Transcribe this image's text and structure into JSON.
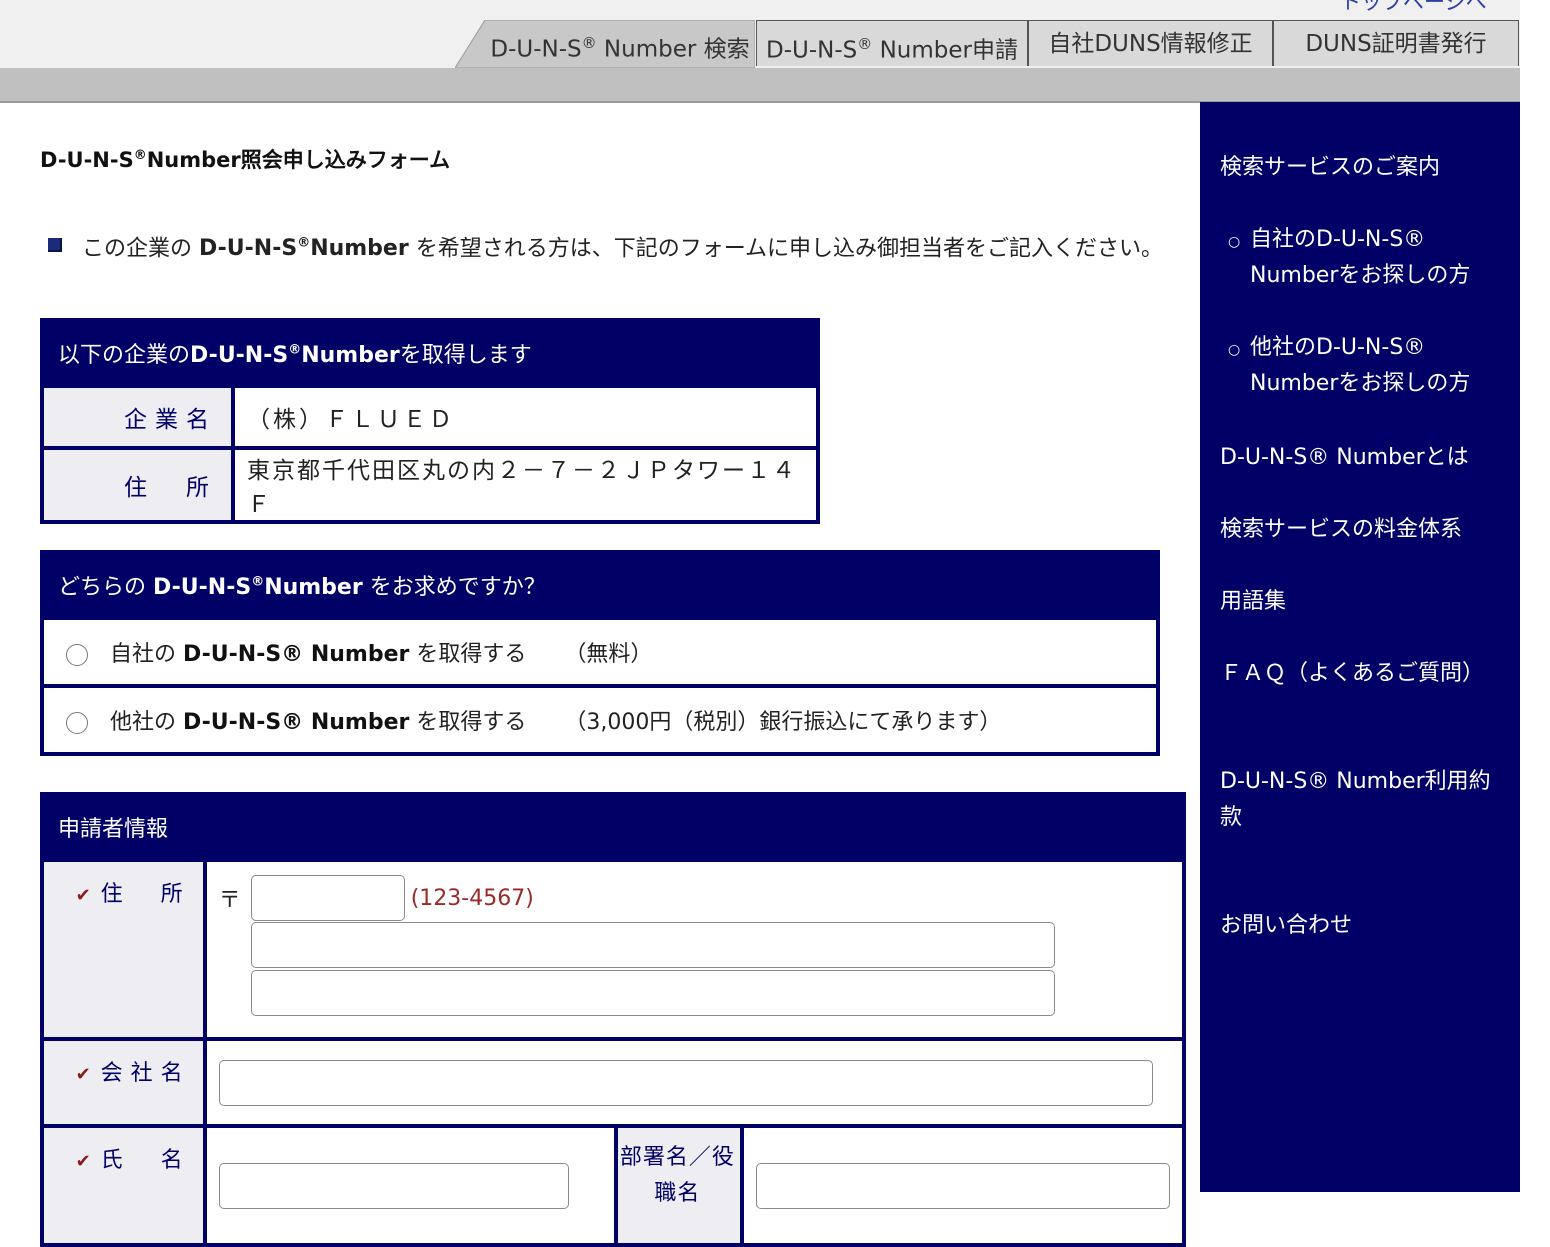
{
  "header": {
    "top_link": "トップページへ",
    "tabs": [
      {
        "label": "D-U-N-S",
        "reg": "®",
        "suffix": " Number 検索"
      },
      {
        "label": "D-U-N-S",
        "reg": "®",
        "suffix": " Number申請"
      },
      {
        "label": "自社DUNS情報修正"
      },
      {
        "label": "DUNS証明書発行"
      }
    ]
  },
  "main": {
    "heading": {
      "prefix": "D-U-N-S",
      "reg": "®",
      "suffix": "Number照会申し込みフォーム"
    },
    "notice": {
      "before": "この企業の ",
      "bold": "D-U-N-S",
      "reg": "®",
      "bold_suffix": "Number",
      "after": " を希望される方は、下記のフォームに申し込み御担当者をご記入ください。"
    },
    "company_box": {
      "title_before": "以下の企業の",
      "title_bold": "D-U-N-S",
      "title_reg": "®",
      "title_bold_suffix": "Number",
      "title_after": "を取得します",
      "name_label": "企業名",
      "name_value": "（株）ＦＬＵＥＤ",
      "address_label": "住　所",
      "address_value": "東京都千代田区丸の内２－７－２ＪＰタワー１４Ｆ"
    },
    "choice_box": {
      "title_before": "どちらの ",
      "title_bold": "D-U-N-S",
      "title_reg": "®",
      "title_bold_suffix": "Number",
      "title_after": " をお求めですか？",
      "options": [
        {
          "before": "自社の ",
          "bold": "D-U-N-S® Number",
          "after": " を取得する",
          "price": "（無料）"
        },
        {
          "before": "他社の ",
          "bold": "D-U-N-S® Number",
          "after": " を取得する",
          "price": "（3,000円（税別）銀行振込にて承ります）"
        }
      ]
    },
    "applicant_box": {
      "title": "申請者情報",
      "address_label": "住　所",
      "zip_mark": "〒",
      "zip_hint": "(123-4567)",
      "company_label": "会社名",
      "name_label": "氏　名",
      "dept_label": "部署名／役職名"
    }
  },
  "sidebar": {
    "items": [
      "検索サービスのご案内",
      "自社のD-U-N-S® Numberをお探しの方",
      "他社のD-U-N-S® Numberをお探しの方",
      "D-U-N-S® Numberとは",
      "検索サービスの料金体系",
      "用語集",
      "ＦＡＱ（よくあるご質問）",
      "D-U-N-S® Number利用約款",
      "お問い合わせ"
    ]
  }
}
